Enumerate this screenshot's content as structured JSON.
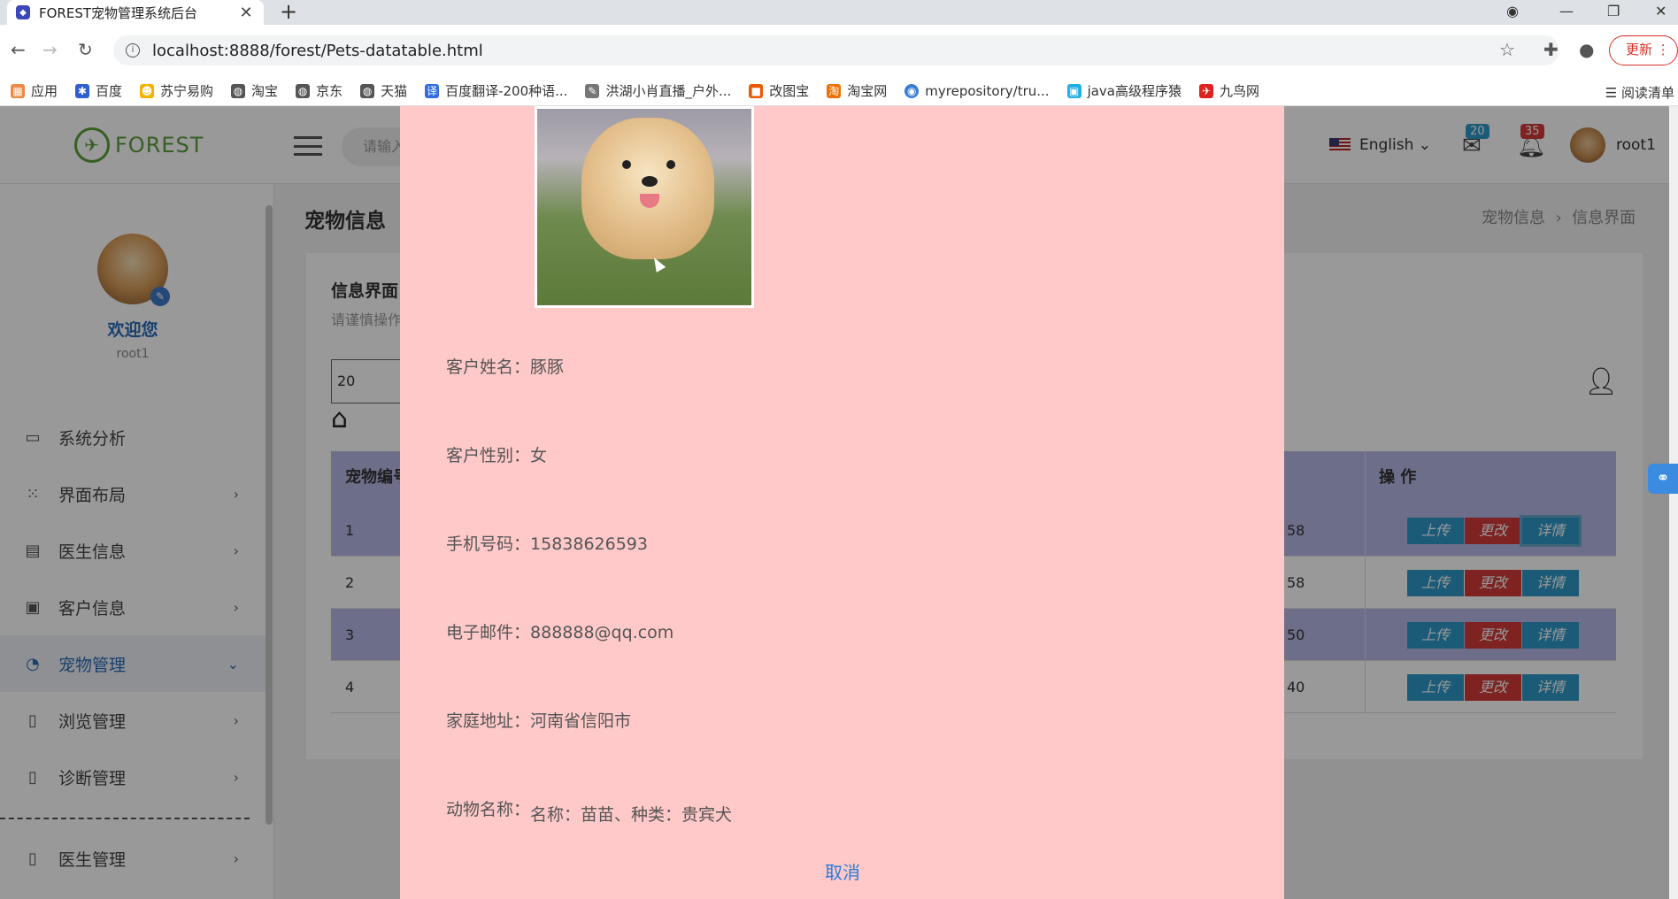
{
  "browser": {
    "tab_title": "FOREST宠物管理系统后台",
    "url": "localhost:8888/forest/Pets-datatable.html",
    "update_label": "更新",
    "bookmarks": [
      "应用",
      "百度",
      "苏宁易购",
      "淘宝",
      "京东",
      "天猫",
      "百度翻译-200种语...",
      "洪湖小肖直播_户外...",
      "改图宝",
      "淘宝网",
      "myrepository/tru...",
      "java高级程序猿",
      "九鸟网"
    ],
    "reading_list": "阅读清单"
  },
  "header": {
    "logo_text": "FOREST",
    "search_placeholder": "请输入",
    "language": "English",
    "mail_badge": "20",
    "bell_badge": "35",
    "username": "root1"
  },
  "sidebar": {
    "welcome": "欢迎您",
    "username": "root1",
    "items": [
      {
        "label": "系统分析",
        "icon": "monitor-icon"
      },
      {
        "label": "界面布局",
        "icon": "grid-icon"
      },
      {
        "label": "医生信息",
        "icon": "calendar-icon"
      },
      {
        "label": "客户信息",
        "icon": "briefcase-icon"
      },
      {
        "label": "宠物管理",
        "icon": "pie-icon"
      },
      {
        "label": "浏览管理",
        "icon": "doc-icon"
      },
      {
        "label": "诊断管理",
        "icon": "doc-icon"
      },
      {
        "label": "医生管理",
        "icon": "doc-icon"
      }
    ]
  },
  "content": {
    "page_title": "宠物信息",
    "breadcrumb": [
      "宠物信息",
      "信息界面"
    ],
    "card_title": "信息界面",
    "card_subtitle": "请谨慎操作",
    "page_size": "20",
    "table": {
      "headers": [
        "宠物编号",
        "操 作"
      ],
      "rows": [
        {
          "id": "1",
          "tail": "58"
        },
        {
          "id": "2",
          "tail": "58"
        },
        {
          "id": "3",
          "tail": "50"
        },
        {
          "id": "4",
          "tail": "40"
        }
      ],
      "buttons": {
        "upload": "上传",
        "edit": "更改",
        "detail": "详情"
      }
    }
  },
  "modal": {
    "fields": [
      {
        "label": "客户姓名：",
        "value": "豚豚"
      },
      {
        "label": "客户性别：",
        "value": "女"
      },
      {
        "label": "手机号码：",
        "value": "15838626593"
      },
      {
        "label": "电子邮件：",
        "value": "888888@qq.com"
      },
      {
        "label": "家庭地址：",
        "value": "河南省信阳市"
      },
      {
        "label": "动物名称：",
        "value": "名称：苗苗、种类：贵宾犬"
      }
    ],
    "cancel_label": "取消"
  }
}
